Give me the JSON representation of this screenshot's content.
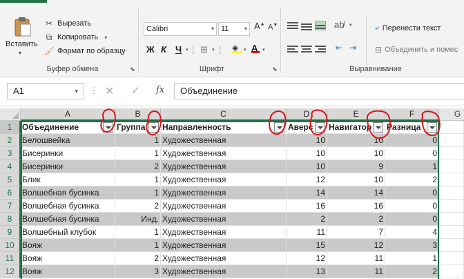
{
  "ribbon": {
    "clipboard": {
      "paste": "Вставить",
      "cut": "Вырезать",
      "copy": "Копировать",
      "format_painter": "Формат по образцу",
      "label": "Буфер обмена"
    },
    "font": {
      "name": "Calibri",
      "size": "11",
      "bold": "Ж",
      "italic": "К",
      "underline": "Ч",
      "label": "Шрифт"
    },
    "alignment": {
      "wrap_text": "Перенести текст",
      "merge": "Объединить и помес",
      "label": "Выравнивание"
    }
  },
  "formula_bar": {
    "name_box": "A1",
    "content": "Объединение"
  },
  "columns": [
    "A",
    "B",
    "C",
    "D",
    "E",
    "F",
    "G"
  ],
  "row_numbers": [
    "1",
    "2",
    "3",
    "4",
    "5",
    "6",
    "7",
    "8",
    "9",
    "10",
    "11",
    "12"
  ],
  "table": {
    "headers": [
      "Объединение",
      "Группа",
      "Направленность",
      "Аверс",
      "Навигатор",
      "Разница"
    ],
    "rows": [
      [
        "Белошвейка",
        "1",
        "Художественная",
        "10",
        "10",
        "0"
      ],
      [
        "Бисеринки",
        "1",
        "Художественная",
        "10",
        "10",
        "0"
      ],
      [
        "Бисеринки",
        "2",
        "Художественная",
        "10",
        "9",
        "1"
      ],
      [
        "Блик",
        "1",
        "Художественная",
        "12",
        "10",
        "2"
      ],
      [
        "Волшебная бусинка",
        "1",
        "Художественная",
        "14",
        "14",
        "0"
      ],
      [
        "Волшебная бусинка",
        "2",
        "Художественная",
        "16",
        "16",
        "0"
      ],
      [
        "Волшебная бусинка",
        "Инд.",
        "Художественная",
        "2",
        "2",
        "0"
      ],
      [
        "Волшебный клубок",
        "1",
        "Художественная",
        "11",
        "7",
        "4"
      ],
      [
        "Вояж",
        "1",
        "Художественная",
        "15",
        "12",
        "3"
      ],
      [
        "Вояж",
        "2",
        "Художественная",
        "12",
        "11",
        "1"
      ],
      [
        "Вояж",
        "3",
        "Художественная",
        "13",
        "11",
        "2"
      ]
    ]
  },
  "colors": {
    "excel_green": "#217346",
    "band_gray": "#c9c9c9",
    "annotation_red": "#d9141b"
  }
}
